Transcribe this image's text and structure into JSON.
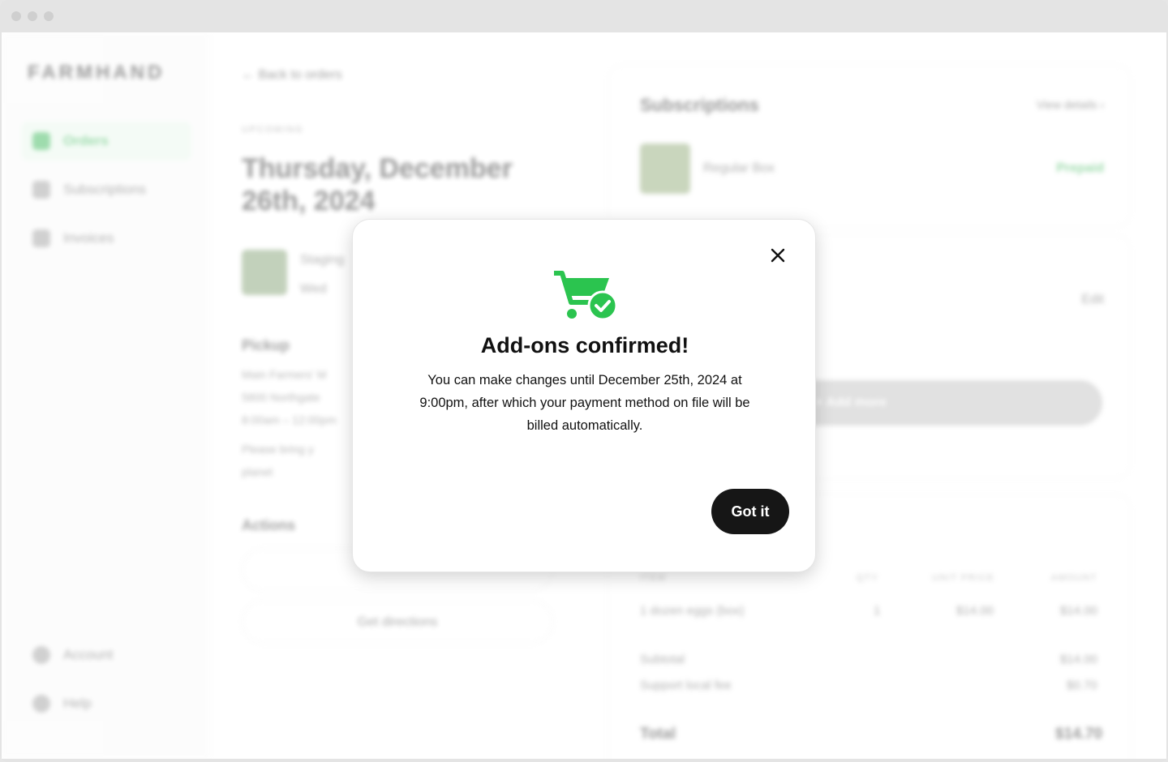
{
  "brand": {
    "logo": "FARMHAND",
    "accent": "#2bb24c"
  },
  "sidebar": {
    "items": [
      {
        "label": "Orders",
        "icon": "cart-icon",
        "active": true
      },
      {
        "label": "Subscriptions",
        "icon": "repeat-icon"
      },
      {
        "label": "Invoices",
        "icon": "receipt-icon"
      }
    ],
    "bottom_items": [
      {
        "label": "Account",
        "icon": "user-icon"
      },
      {
        "label": "Help",
        "icon": "help-icon"
      }
    ]
  },
  "order": {
    "back_label": "← Back to orders",
    "status": "UPCOMING",
    "date_title": "Thursday, December 26th, 2024",
    "item_name": "Staging",
    "item_sub": "Wed",
    "pickup_heading": "Pickup",
    "pickup_lines": [
      "Main Farmers' M",
      "5800 Northgate",
      "8:00am – 12:00pm"
    ],
    "pickup_note": "Please bring y",
    "pickup_note2": "planet",
    "actions_heading": "Actions",
    "action_buttons": [
      "",
      "Get directions"
    ]
  },
  "subscriptions_card": {
    "title": "Subscriptions",
    "view_details": "View details ›",
    "item_name": "Regular Box",
    "status": "Prepaid"
  },
  "addons_card": {
    "edit_label": "Edit",
    "add_more_label": "+ Add more"
  },
  "invoice": {
    "columns": [
      "ITEM",
      "QTY",
      "UNIT PRICE",
      "AMOUNT"
    ],
    "rows": [
      {
        "item": "1 dozen eggs (box)",
        "qty": "1",
        "unit": "$14.00",
        "amount": "$14.00"
      }
    ],
    "subtotal_label": "Subtotal",
    "subtotal": "$14.00",
    "fee_label": "Support local fee",
    "fee": "$0.70",
    "total_label": "Total",
    "total": "$14.70"
  },
  "modal": {
    "title": "Add-ons confirmed!",
    "body": "You can make changes until December 25th, 2024 at 9:00pm, after which your payment method on file will be billed automatically.",
    "confirm_label": "Got it",
    "icon": "cart-check-icon",
    "icon_color": "#2bc44f"
  }
}
